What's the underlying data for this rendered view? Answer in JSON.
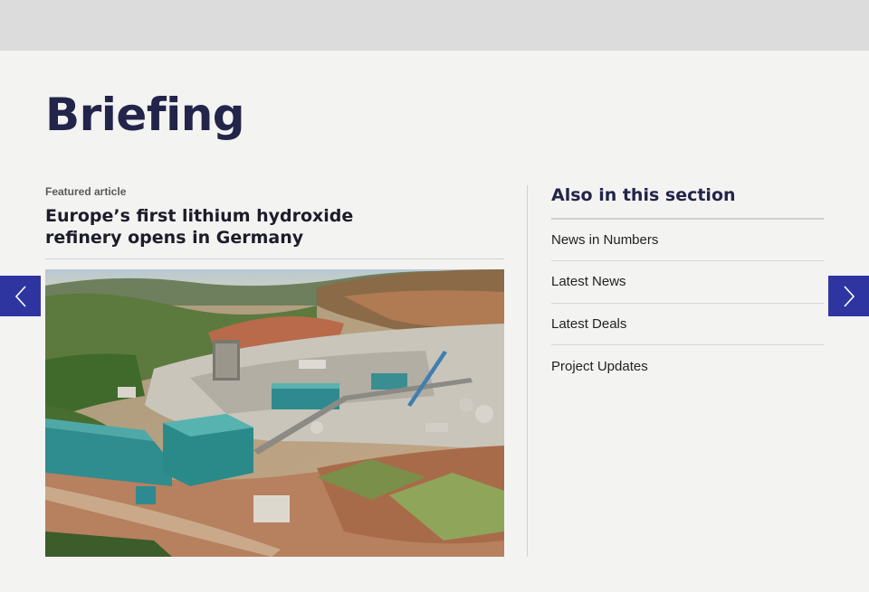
{
  "page": {
    "title": "Briefing"
  },
  "featured": {
    "kicker": "Featured article",
    "headline": "Europe’s first lithium hydroxide refinery opens in Germany",
    "image_alt": "Aerial view of an industrial refinery plant on a hillside"
  },
  "aside": {
    "title": "Also in this section",
    "items": [
      {
        "label": "News in Numbers"
      },
      {
        "label": "Latest News"
      },
      {
        "label": "Latest Deals"
      },
      {
        "label": "Project Updates"
      }
    ]
  },
  "carousel": {
    "prev_icon": "chevron-left-icon",
    "next_icon": "chevron-right-icon"
  },
  "colors": {
    "accent": "#2f35a0",
    "title": "#23244a",
    "background": "#f3f3f2",
    "topbar": "#dcdcdc"
  }
}
